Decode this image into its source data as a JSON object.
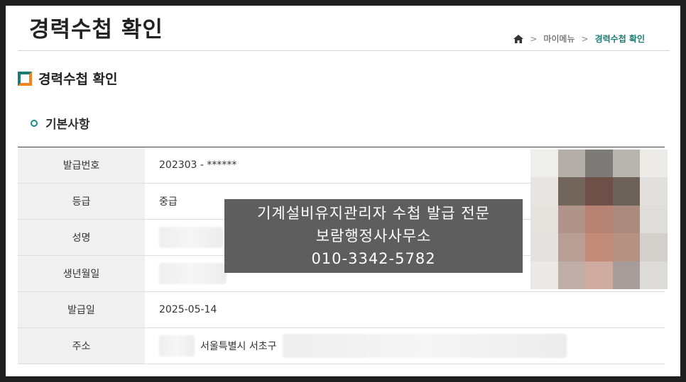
{
  "page": {
    "title": "경력수첩 확인",
    "breadcrumb": [
      "마이메뉴",
      "경력수첩 확인"
    ],
    "breadcrumb_icons": [
      "home-icon",
      "chevron-right-icon"
    ]
  },
  "section": {
    "title": "경력수첩 확인",
    "subsection": "기본사항"
  },
  "table": {
    "rows": [
      {
        "label": "발급번호",
        "value": "202303 - ******"
      },
      {
        "label": "등급",
        "value": "중급"
      },
      {
        "label": "성명",
        "value": ""
      },
      {
        "label": "생년월일",
        "value": ""
      },
      {
        "label": "발급일",
        "value": "2025-05-14"
      },
      {
        "label": "주소",
        "value": "서울특별시 서초구"
      }
    ]
  },
  "overlay": {
    "line1": "기계설비유지관리자 수첩 발급 전문",
    "line2": "보람행정사사무소",
    "line3": "010-3342-5782"
  },
  "colors": {
    "accent": "#1c7c72",
    "icon_orange": "#f2861e",
    "label_bg": "#f0f0f0",
    "overlay_bg": "#484848"
  }
}
